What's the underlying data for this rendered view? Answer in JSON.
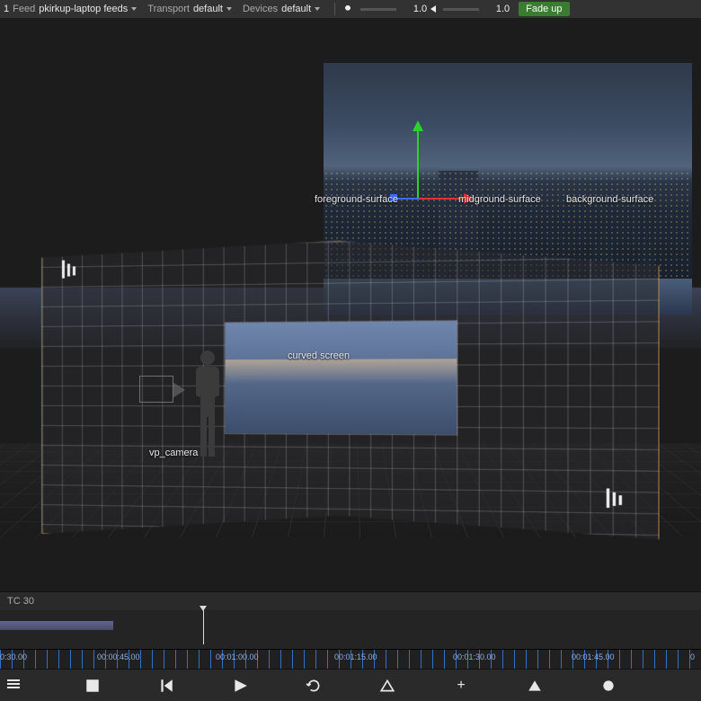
{
  "topbar": {
    "suffix": "1",
    "feed_label": "Feed",
    "feed_value": "pkirkup-laptop feeds",
    "transport_label": "Transport",
    "transport_value": "default",
    "devices_label": "Devices",
    "devices_value": "default",
    "brightness": "1.0",
    "volume": "1.0",
    "fade_button": "Fade up"
  },
  "scene": {
    "labels": {
      "foreground": "foreground-surface",
      "midground": "midground-surface",
      "background": "background-surface",
      "curved_screen": "curved screen",
      "camera": "vp_camera"
    }
  },
  "timeline": {
    "tc_label": "TC 30",
    "ruler": [
      "0:30.00",
      "00:00:45.00",
      "00:01:00.00",
      "00:01:15.00",
      "00:01:30.00",
      "00:01:45.00",
      "0"
    ]
  }
}
